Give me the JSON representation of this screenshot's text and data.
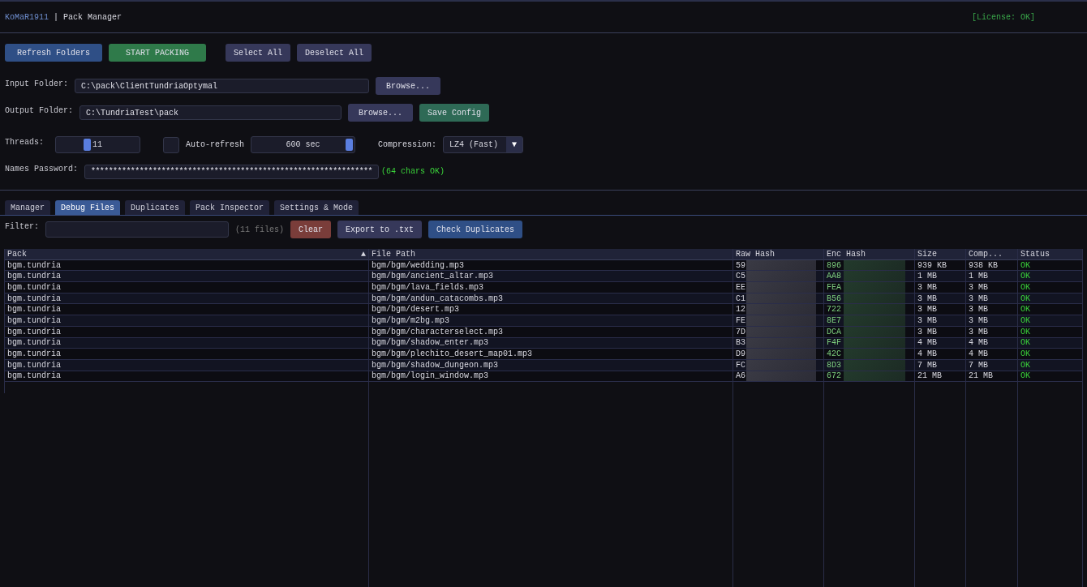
{
  "header": {
    "brand": "KoMaR1911",
    "separator": "|",
    "title": "Pack Manager",
    "license": "[License: OK]"
  },
  "actions": [
    {
      "label": "Refresh Folders",
      "kind": "primary"
    },
    {
      "label": "START PACKING",
      "kind": "go"
    },
    {
      "label": "Select All",
      "kind": "plain"
    },
    {
      "label": "Deselect All",
      "kind": "plain"
    }
  ],
  "input_folder": {
    "label": "Input Folder:",
    "value": "C:\\pack\\ClientTundriaOptymal",
    "browse": "Browse..."
  },
  "output_folder": {
    "label": "Output Folder:",
    "value": "C:\\TundriaTest\\pack",
    "browse": "Browse...",
    "save": "Save Config"
  },
  "threads": {
    "label": "Threads:",
    "value": "11",
    "level": 0.35
  },
  "auto_refresh": {
    "label": "Auto-refresh",
    "checked": false,
    "value": "600 sec",
    "level": 1
  },
  "compression": {
    "label": "Compression:",
    "value": "LZ4 (Fast)",
    "arrow": "▼"
  },
  "password": {
    "label": "Names Password:",
    "value": "****************************************************************",
    "note": "(64 chars OK)"
  },
  "tabs": [
    {
      "label": "Manager",
      "selected": false
    },
    {
      "label": "Debug Files",
      "selected": true
    },
    {
      "label": "Duplicates",
      "selected": false
    },
    {
      "label": "Pack Inspector",
      "selected": false
    },
    {
      "label": "Settings & Mode",
      "selected": false
    }
  ],
  "filter": {
    "label": "Filter:",
    "count": "(11 files)",
    "buttons": [
      {
        "label": "Clear",
        "kind": "danger"
      },
      {
        "label": "Export to .txt",
        "kind": "plain"
      },
      {
        "label": "Check Duplicates",
        "kind": "primary"
      }
    ]
  },
  "table": {
    "columns": [
      {
        "label": "Pack",
        "sort": "▲"
      },
      {
        "label": "File Path"
      },
      {
        "label": "Raw Hash"
      },
      {
        "label": "Enc Hash"
      },
      {
        "label": "Size"
      },
      {
        "label": "Comp..."
      },
      {
        "label": "Status"
      }
    ],
    "rows": [
      [
        "bgm.tundria",
        "bgm/bgm/wedding.mp3",
        "59",
        "896",
        "939 KB",
        "938 KB",
        "OK"
      ],
      [
        "bgm.tundria",
        "bgm/bgm/ancient_altar.mp3",
        "C5",
        "AA8",
        "1 MB",
        "1 MB",
        "OK"
      ],
      [
        "bgm.tundria",
        "bgm/bgm/lava_fields.mp3",
        "EE",
        "FEA",
        "3 MB",
        "3 MB",
        "OK"
      ],
      [
        "bgm.tundria",
        "bgm/bgm/andun_catacombs.mp3",
        "C1",
        "B56",
        "3 MB",
        "3 MB",
        "OK"
      ],
      [
        "bgm.tundria",
        "bgm/bgm/desert.mp3",
        "12",
        "722",
        "3 MB",
        "3 MB",
        "OK"
      ],
      [
        "bgm.tundria",
        "bgm/bgm/m2bg.mp3",
        "FE",
        "8E7",
        "3 MB",
        "3 MB",
        "OK"
      ],
      [
        "bgm.tundria",
        "bgm/bgm/characterselect.mp3",
        "7D",
        "DCA",
        "3 MB",
        "3 MB",
        "OK"
      ],
      [
        "bgm.tundria",
        "bgm/bgm/shadow_enter.mp3",
        "B3",
        "F4F",
        "4 MB",
        "4 MB",
        "OK"
      ],
      [
        "bgm.tundria",
        "bgm/bgm/plechito_desert_map01.mp3",
        "D9",
        "42C",
        "4 MB",
        "4 MB",
        "OK"
      ],
      [
        "bgm.tundria",
        "bgm/bgm/shadow_dungeon.mp3",
        "FC",
        "8D3",
        "7 MB",
        "7 MB",
        "OK"
      ],
      [
        "bgm.tundria",
        "bgm/bgm/login_window.mp3",
        "A6",
        "672",
        "21 MB",
        "21 MB",
        "OK"
      ]
    ]
  }
}
